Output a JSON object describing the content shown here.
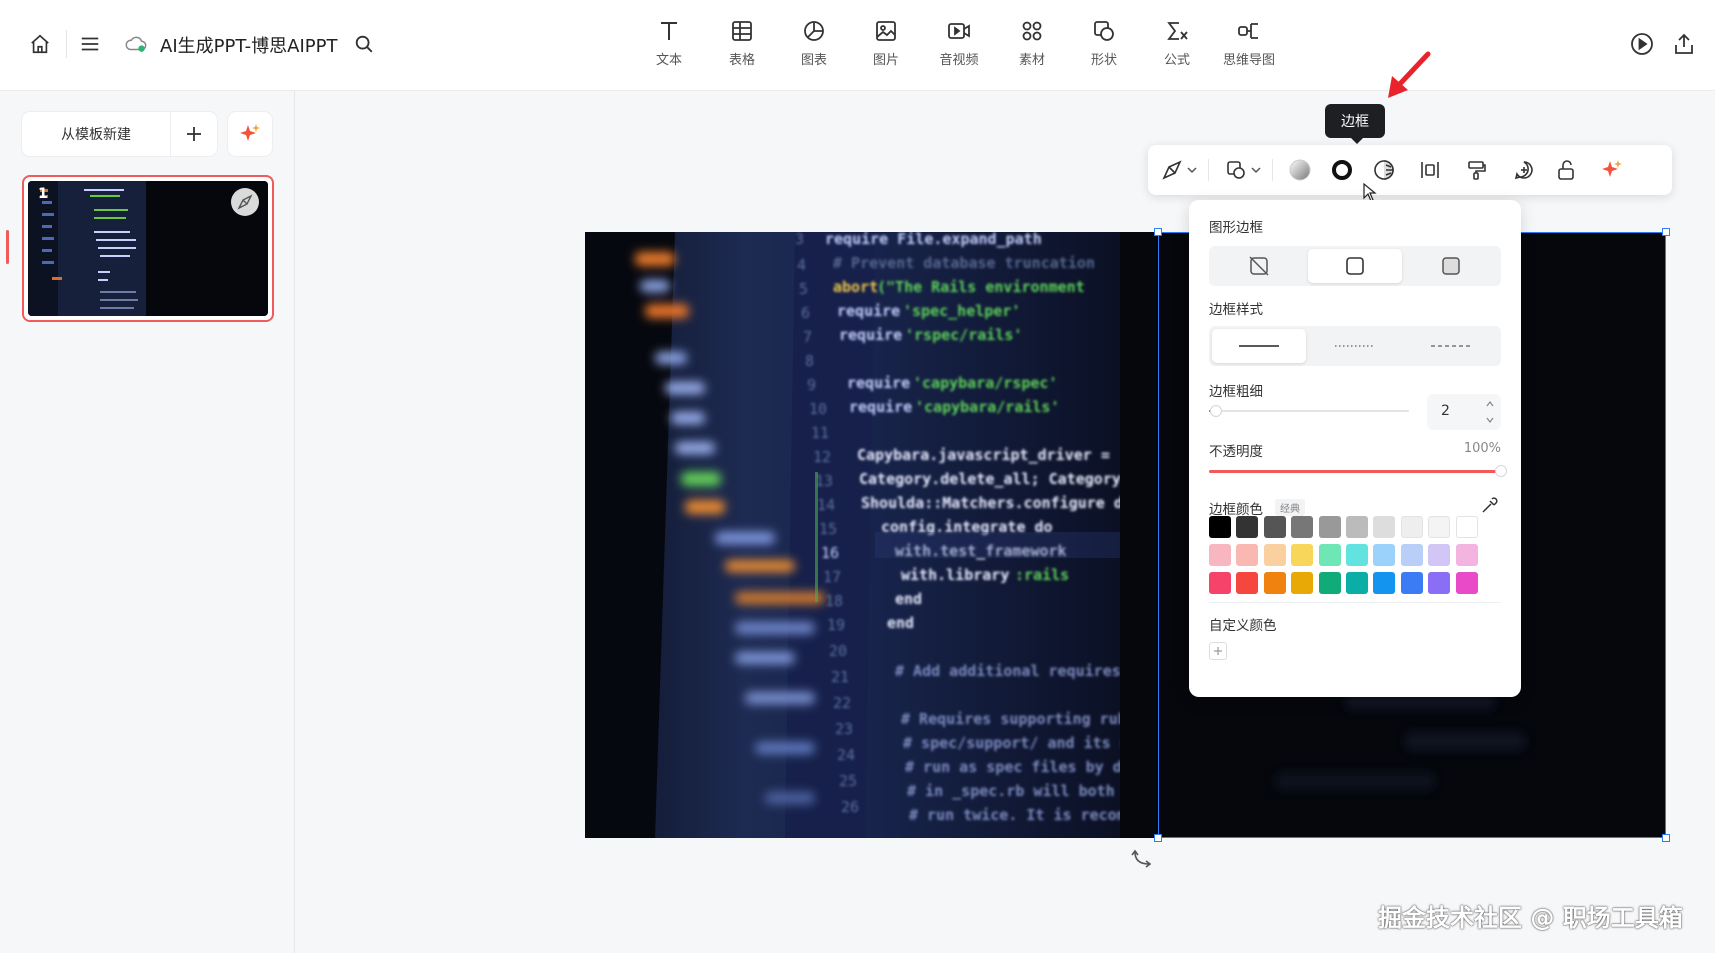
{
  "app": {
    "title": "AI生成PPT-博思AIPPT"
  },
  "toolbar": {
    "inserts": [
      {
        "label": "文本",
        "icon": "text-icon"
      },
      {
        "label": "表格",
        "icon": "table-icon"
      },
      {
        "label": "图表",
        "icon": "chart-icon"
      },
      {
        "label": "图片",
        "icon": "image-icon"
      },
      {
        "label": "音视频",
        "icon": "video-icon"
      },
      {
        "label": "素材",
        "icon": "assets-icon"
      },
      {
        "label": "形状",
        "icon": "shape-icon"
      },
      {
        "label": "公式",
        "icon": "formula-icon"
      },
      {
        "label": "思维导图",
        "icon": "mindmap-icon"
      }
    ]
  },
  "sidebar": {
    "new_from_template": "从模板新建",
    "slides": [
      {
        "number": "1"
      }
    ]
  },
  "tooltip": {
    "text": "边框"
  },
  "border_panel": {
    "shape_border_label": "图形边框",
    "border_style_label": "边框样式",
    "border_width_label": "边框粗细",
    "border_width_value": "2",
    "opacity_label": "不透明度",
    "opacity_value": "100%",
    "opacity_fraction": 1.0,
    "border_color_label": "边框颜色",
    "palette_tag": "经典",
    "custom_color_label": "自定义颜色",
    "swatches": [
      [
        "#000000",
        "#333333",
        "#555555",
        "#777777",
        "#999999",
        "#bbbbbb",
        "#dddddd",
        "#eeeeee",
        "#f4f4f4",
        "#ffffff"
      ],
      [
        "#f7b6c0",
        "#f9b9b2",
        "#fbd0a0",
        "#f8d65a",
        "#6ee6b5",
        "#63e3e0",
        "#9bd2fb",
        "#b9cff8",
        "#d2c6f7",
        "#f4b4e2"
      ],
      [
        "#f5436a",
        "#f5473d",
        "#f0820f",
        "#e8a805",
        "#10ab78",
        "#0aaea6",
        "#1394ef",
        "#3b7cf5",
        "#8a6ef6",
        "#e94ac8"
      ]
    ]
  },
  "watermark": {
    "text": "掘金技术社区 @ 职场工具箱"
  },
  "colors": {
    "accent": "#f05a5a",
    "selection": "#2f7bf6"
  }
}
